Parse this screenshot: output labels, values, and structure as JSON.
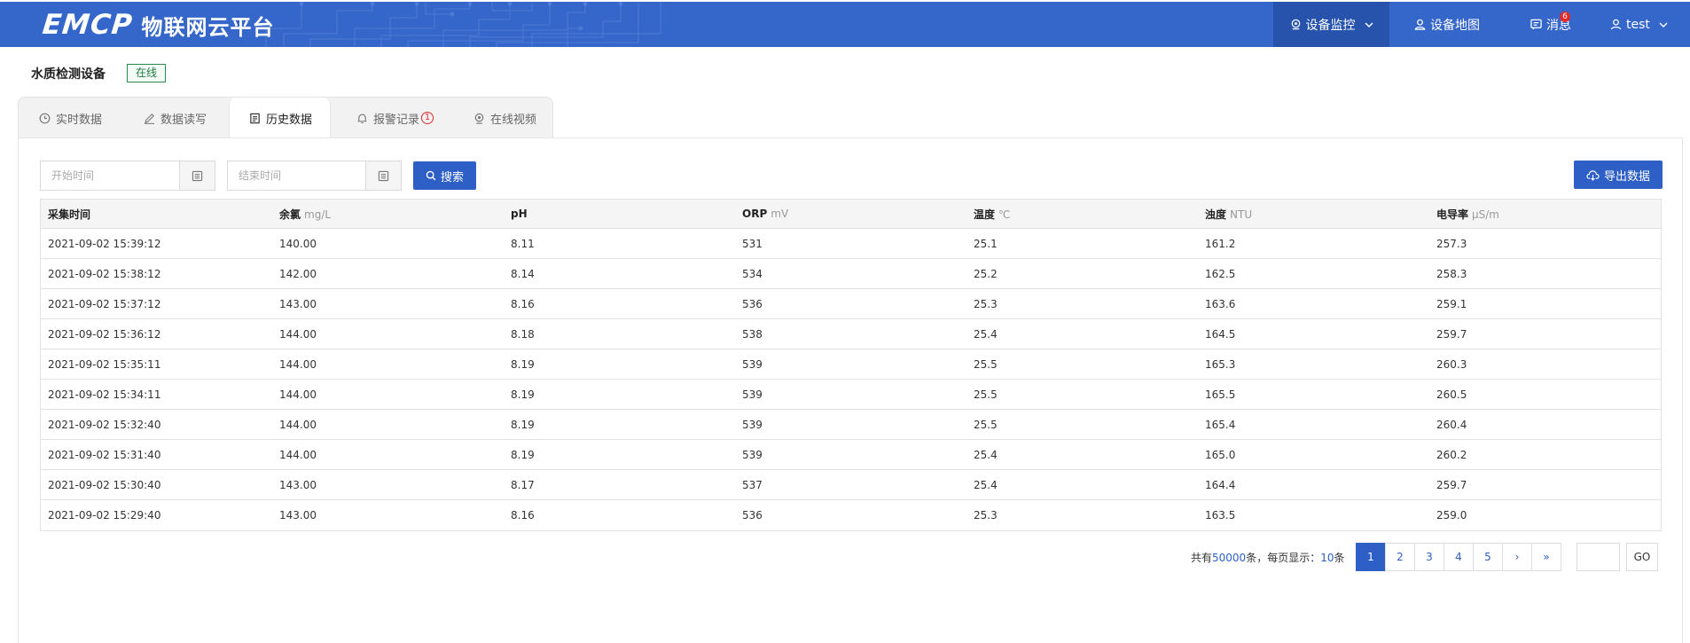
{
  "brand": {
    "logo": "EMCP",
    "name": "物联网云平台"
  },
  "nav": [
    {
      "label": "设备监控",
      "icon": "location-pin-icon",
      "dropdown": true,
      "active": true
    },
    {
      "label": "设备地图",
      "icon": "user-map-icon"
    },
    {
      "label": "消息",
      "icon": "message-icon",
      "badge": "6"
    },
    {
      "label": "test",
      "icon": "user-icon",
      "dropdown": true
    }
  ],
  "device": {
    "name": "水质检测设备",
    "status": "在线"
  },
  "tabs": [
    {
      "label": "实时数据",
      "icon": "clock-icon"
    },
    {
      "label": "数据读写",
      "icon": "pencil-icon"
    },
    {
      "label": "历史数据",
      "icon": "document-icon",
      "active": true
    },
    {
      "label": "报警记录",
      "icon": "bell-icon",
      "alert": "1"
    },
    {
      "label": "在线视频",
      "icon": "camera-icon"
    }
  ],
  "filters": {
    "start_placeholder": "开始时间",
    "end_placeholder": "结束时间",
    "search_label": "搜索",
    "export_label": "导出数据"
  },
  "table": {
    "headers": [
      {
        "name": "采集时间",
        "unit": ""
      },
      {
        "name": "余氯",
        "unit": "mg/L"
      },
      {
        "name": "pH",
        "unit": ""
      },
      {
        "name": "ORP",
        "unit": "mV"
      },
      {
        "name": "温度",
        "unit": "℃"
      },
      {
        "name": "浊度",
        "unit": "NTU"
      },
      {
        "name": "电导率",
        "unit": "µS/m"
      }
    ],
    "rows": [
      [
        "2021-09-02 15:39:12",
        "140.00",
        "8.11",
        "531",
        "25.1",
        "161.2",
        "257.3"
      ],
      [
        "2021-09-02 15:38:12",
        "142.00",
        "8.14",
        "534",
        "25.2",
        "162.5",
        "258.3"
      ],
      [
        "2021-09-02 15:37:12",
        "143.00",
        "8.16",
        "536",
        "25.3",
        "163.6",
        "259.1"
      ],
      [
        "2021-09-02 15:36:12",
        "144.00",
        "8.18",
        "538",
        "25.4",
        "164.5",
        "259.7"
      ],
      [
        "2021-09-02 15:35:11",
        "144.00",
        "8.19",
        "539",
        "25.5",
        "165.3",
        "260.3"
      ],
      [
        "2021-09-02 15:34:11",
        "144.00",
        "8.19",
        "539",
        "25.5",
        "165.5",
        "260.5"
      ],
      [
        "2021-09-02 15:32:40",
        "144.00",
        "8.19",
        "539",
        "25.5",
        "165.4",
        "260.4"
      ],
      [
        "2021-09-02 15:31:40",
        "144.00",
        "8.19",
        "539",
        "25.4",
        "165.0",
        "260.2"
      ],
      [
        "2021-09-02 15:30:40",
        "143.00",
        "8.17",
        "537",
        "25.4",
        "164.4",
        "259.7"
      ],
      [
        "2021-09-02 15:29:40",
        "143.00",
        "8.16",
        "536",
        "25.3",
        "163.5",
        "259.0"
      ]
    ]
  },
  "pagination": {
    "total_prefix": "共有",
    "total": "50000",
    "total_suffix": "条，每页显示：",
    "per_page": "10",
    "per_page_suffix": "条",
    "pages": [
      "1",
      "2",
      "3",
      "4",
      "5",
      "›",
      "»"
    ],
    "current": "1",
    "go_label": "GO"
  },
  "colors": {
    "header": "#3566c9",
    "header_active": "#2753ad",
    "primary": "#2d5fc6",
    "online": "#2a8a4b",
    "alert": "#e02a2a"
  }
}
